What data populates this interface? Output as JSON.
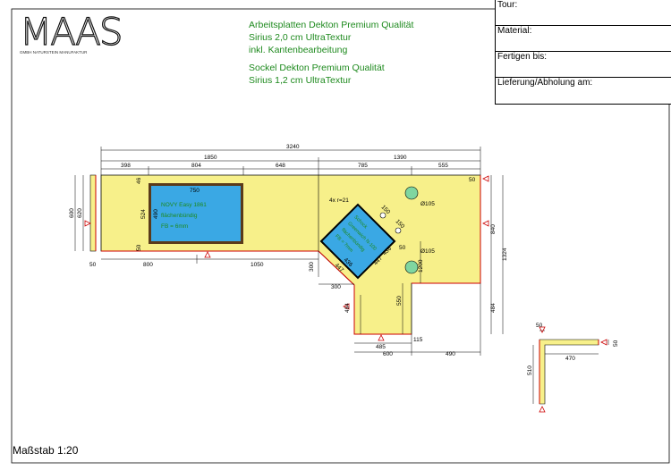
{
  "logo": {
    "mark": "MAAS",
    "subtitle": "GMBH NATURSTEIN MANUFAKTUR"
  },
  "notes": {
    "line1": "Arbeitsplatten Dekton Premium Qualität",
    "line2": "Sirius 2,0 cm UltraTextur",
    "line3": "inkl. Kantenbearbeitung",
    "line4": "Sockel Dekton Premium Qualität",
    "line5": "Sirius 1,2 cm UltraTextur"
  },
  "infobox": {
    "tour": "Tour:",
    "material": "Material:",
    "fertigen": "Fertigen bis:",
    "lieferung": "Lieferung/Abholung am:"
  },
  "scale": "Maßstab 1:20",
  "drawing": {
    "dims": {
      "d3240": "3240",
      "d1850": "1850",
      "d1390": "1390",
      "d398": "398",
      "d804": "804",
      "d648": "648",
      "d785": "785",
      "d555": "555",
      "d50a": "50",
      "d750": "750",
      "d46": "46",
      "d524": "524",
      "d490": "490",
      "d50b": "50",
      "d600": "600",
      "d620": "620",
      "d50c": "50",
      "d800": "800",
      "d1050": "1050",
      "d300v": "300",
      "d300h": "300",
      "d4x": "4x r=21",
      "d150a": "150",
      "d150b": "150",
      "d105a": "Ø105",
      "d105b": "Ø105",
      "d447a": "447",
      "d447b": "447",
      "d436": "436",
      "d436b": "436",
      "d50d": "50",
      "d1200": "1200",
      "d550": "550",
      "d494": "494",
      "d485": "485",
      "d115": "115",
      "d600b": "600",
      "d490b": "490",
      "d840": "840",
      "d1324": "1324",
      "d484": "484",
      "d50e": "50",
      "d50f": "50",
      "d470": "470",
      "d510": "510"
    },
    "sink1": {
      "l1": "NOVY Easy 1861",
      "l2": "flächenbündig",
      "l3": "FB = 6mm"
    },
    "sink2": {
      "l1": "Schock",
      "l2": "Greenwich N-100",
      "l3": "flächenbündig",
      "l4": "FB = 7mm"
    }
  },
  "colors": {
    "counter": "#f7f08a",
    "sink": "#3aa8e4",
    "edge": "#cc0000",
    "note": "#1e8a1e",
    "hole": "#7fd6a0"
  }
}
